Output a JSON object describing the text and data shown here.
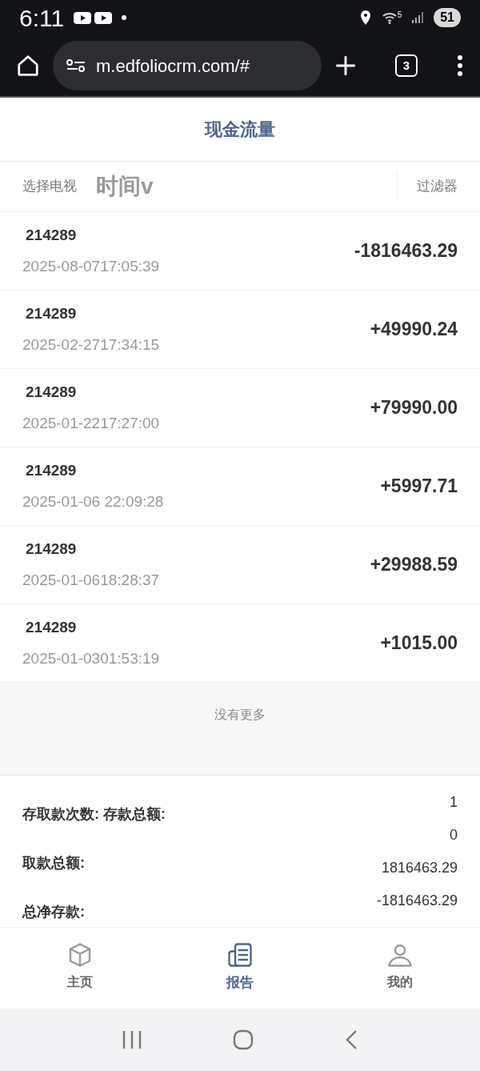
{
  "status_bar": {
    "time": "6:11",
    "battery": "51",
    "wifi_badge": "5"
  },
  "browser": {
    "url": "m.edfoliocrm.com/#",
    "tab_count": "3"
  },
  "page_title": "现金流量",
  "filter_bar": {
    "select_label": "选择电视",
    "time_label": "时间v",
    "filter_button": "过滤器"
  },
  "transactions": [
    {
      "id": "214289",
      "datetime": "2025-08-0717:05:39",
      "amount": "-1816463.29"
    },
    {
      "id": "214289",
      "datetime": "2025-02-2717:34:15",
      "amount": "+49990.24"
    },
    {
      "id": "214289",
      "datetime": "2025-01-2217:27:00",
      "amount": "+79990.00"
    },
    {
      "id": "214289",
      "datetime": "2025-01-06 22:09:28",
      "amount": "+5997.71"
    },
    {
      "id": "214289",
      "datetime": "2025-01-0618:28:37",
      "amount": "+29988.59"
    },
    {
      "id": "214289",
      "datetime": "2025-01-0301:53:19",
      "amount": "+1015.00"
    }
  ],
  "no_more": "没有更多",
  "summary": {
    "labels": [
      "存取款次数: 存款总额:",
      "取款总额:",
      "总净存款:"
    ],
    "values": [
      "1",
      "0",
      "1816463.29",
      "-1816463.29"
    ]
  },
  "tab_bar": [
    {
      "kind": "home",
      "label": "主页",
      "selected": false
    },
    {
      "kind": "report",
      "label": "报告",
      "selected": true
    },
    {
      "kind": "me",
      "label": "我的",
      "selected": false
    }
  ]
}
